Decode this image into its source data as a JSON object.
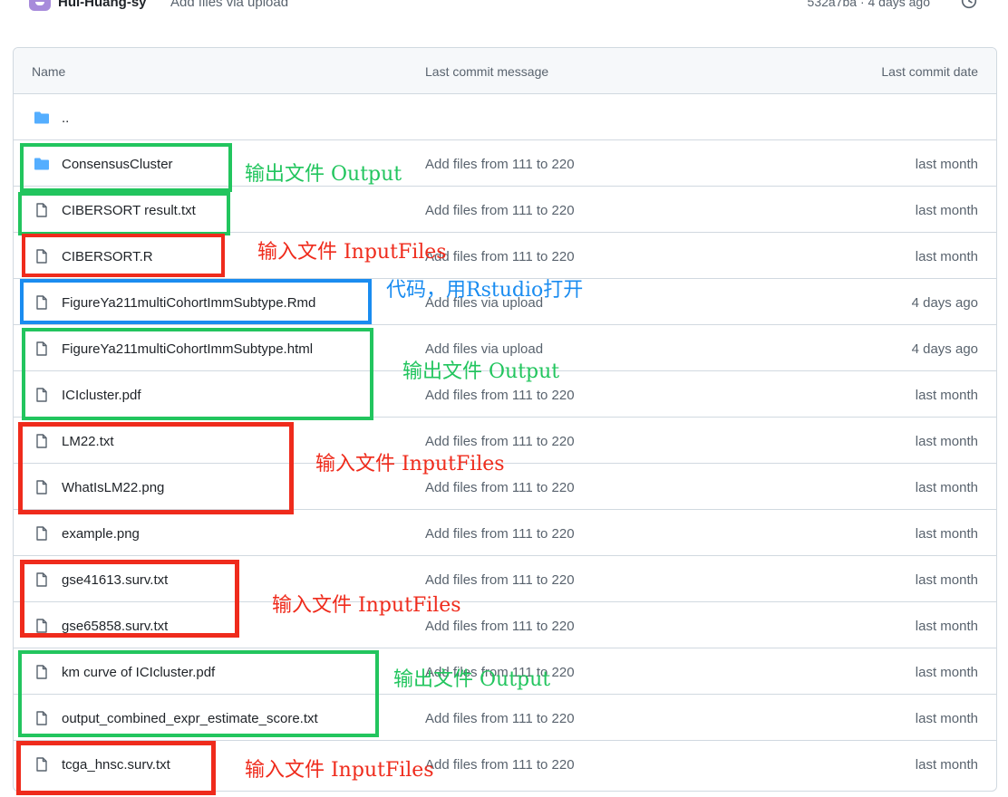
{
  "latest_commit": {
    "author": "Hui-Huang-sy",
    "message": "Add files via upload",
    "meta": "532a7ba · 4 days ago"
  },
  "table": {
    "headers": {
      "name": "Name",
      "message": "Last commit message",
      "date": "Last commit date"
    },
    "parent_dir": "..",
    "rows": [
      {
        "name": "ConsensusCluster",
        "type": "folder",
        "message": "Add files from 111 to 220",
        "date": "last month"
      },
      {
        "name": "CIBERSORT result.txt",
        "type": "file",
        "message": "Add files from 111 to 220",
        "date": "last month"
      },
      {
        "name": "CIBERSORT.R",
        "type": "file",
        "message": "Add files from 111 to 220",
        "date": "last month"
      },
      {
        "name": "FigureYa211multiCohortImmSubtype.Rmd",
        "type": "file",
        "message": "Add files via upload",
        "date": "4 days ago"
      },
      {
        "name": "FigureYa211multiCohortImmSubtype.html",
        "type": "file",
        "message": "Add files via upload",
        "date": "4 days ago"
      },
      {
        "name": "ICIcluster.pdf",
        "type": "file",
        "message": "Add files from 111 to 220",
        "date": "last month"
      },
      {
        "name": "LM22.txt",
        "type": "file",
        "message": "Add files from 111 to 220",
        "date": "last month"
      },
      {
        "name": "WhatIsLM22.png",
        "type": "file",
        "message": "Add files from 111 to 220",
        "date": "last month"
      },
      {
        "name": "example.png",
        "type": "file",
        "message": "Add files from 111 to 220",
        "date": "last month"
      },
      {
        "name": "gse41613.surv.txt",
        "type": "file",
        "message": "Add files from 111 to 220",
        "date": "last month"
      },
      {
        "name": "gse65858.surv.txt",
        "type": "file",
        "message": "Add files from 111 to 220",
        "date": "last month"
      },
      {
        "name": "km curve of ICIcluster.pdf",
        "type": "file",
        "message": "Add files from 111 to 220",
        "date": "last month"
      },
      {
        "name": "output_combined_expr_estimate_score.txt",
        "type": "file",
        "message": "Add files from 111 to 220",
        "date": "last month"
      },
      {
        "name": "tcga_hnsc.surv.txt",
        "type": "file",
        "message": "Add files from 111 to 220",
        "date": "last month"
      }
    ]
  },
  "annotations": {
    "output": "输出文件 Output",
    "input": "输入文件 InputFiles",
    "code": "代码，用Rstudio打开",
    "colors": {
      "output": "#22c55e",
      "input": "#ef2b1c",
      "code": "#1a8cf0"
    }
  },
  "icons": {
    "folder": "folder-icon",
    "file": "file-icon",
    "history": "history-icon"
  }
}
